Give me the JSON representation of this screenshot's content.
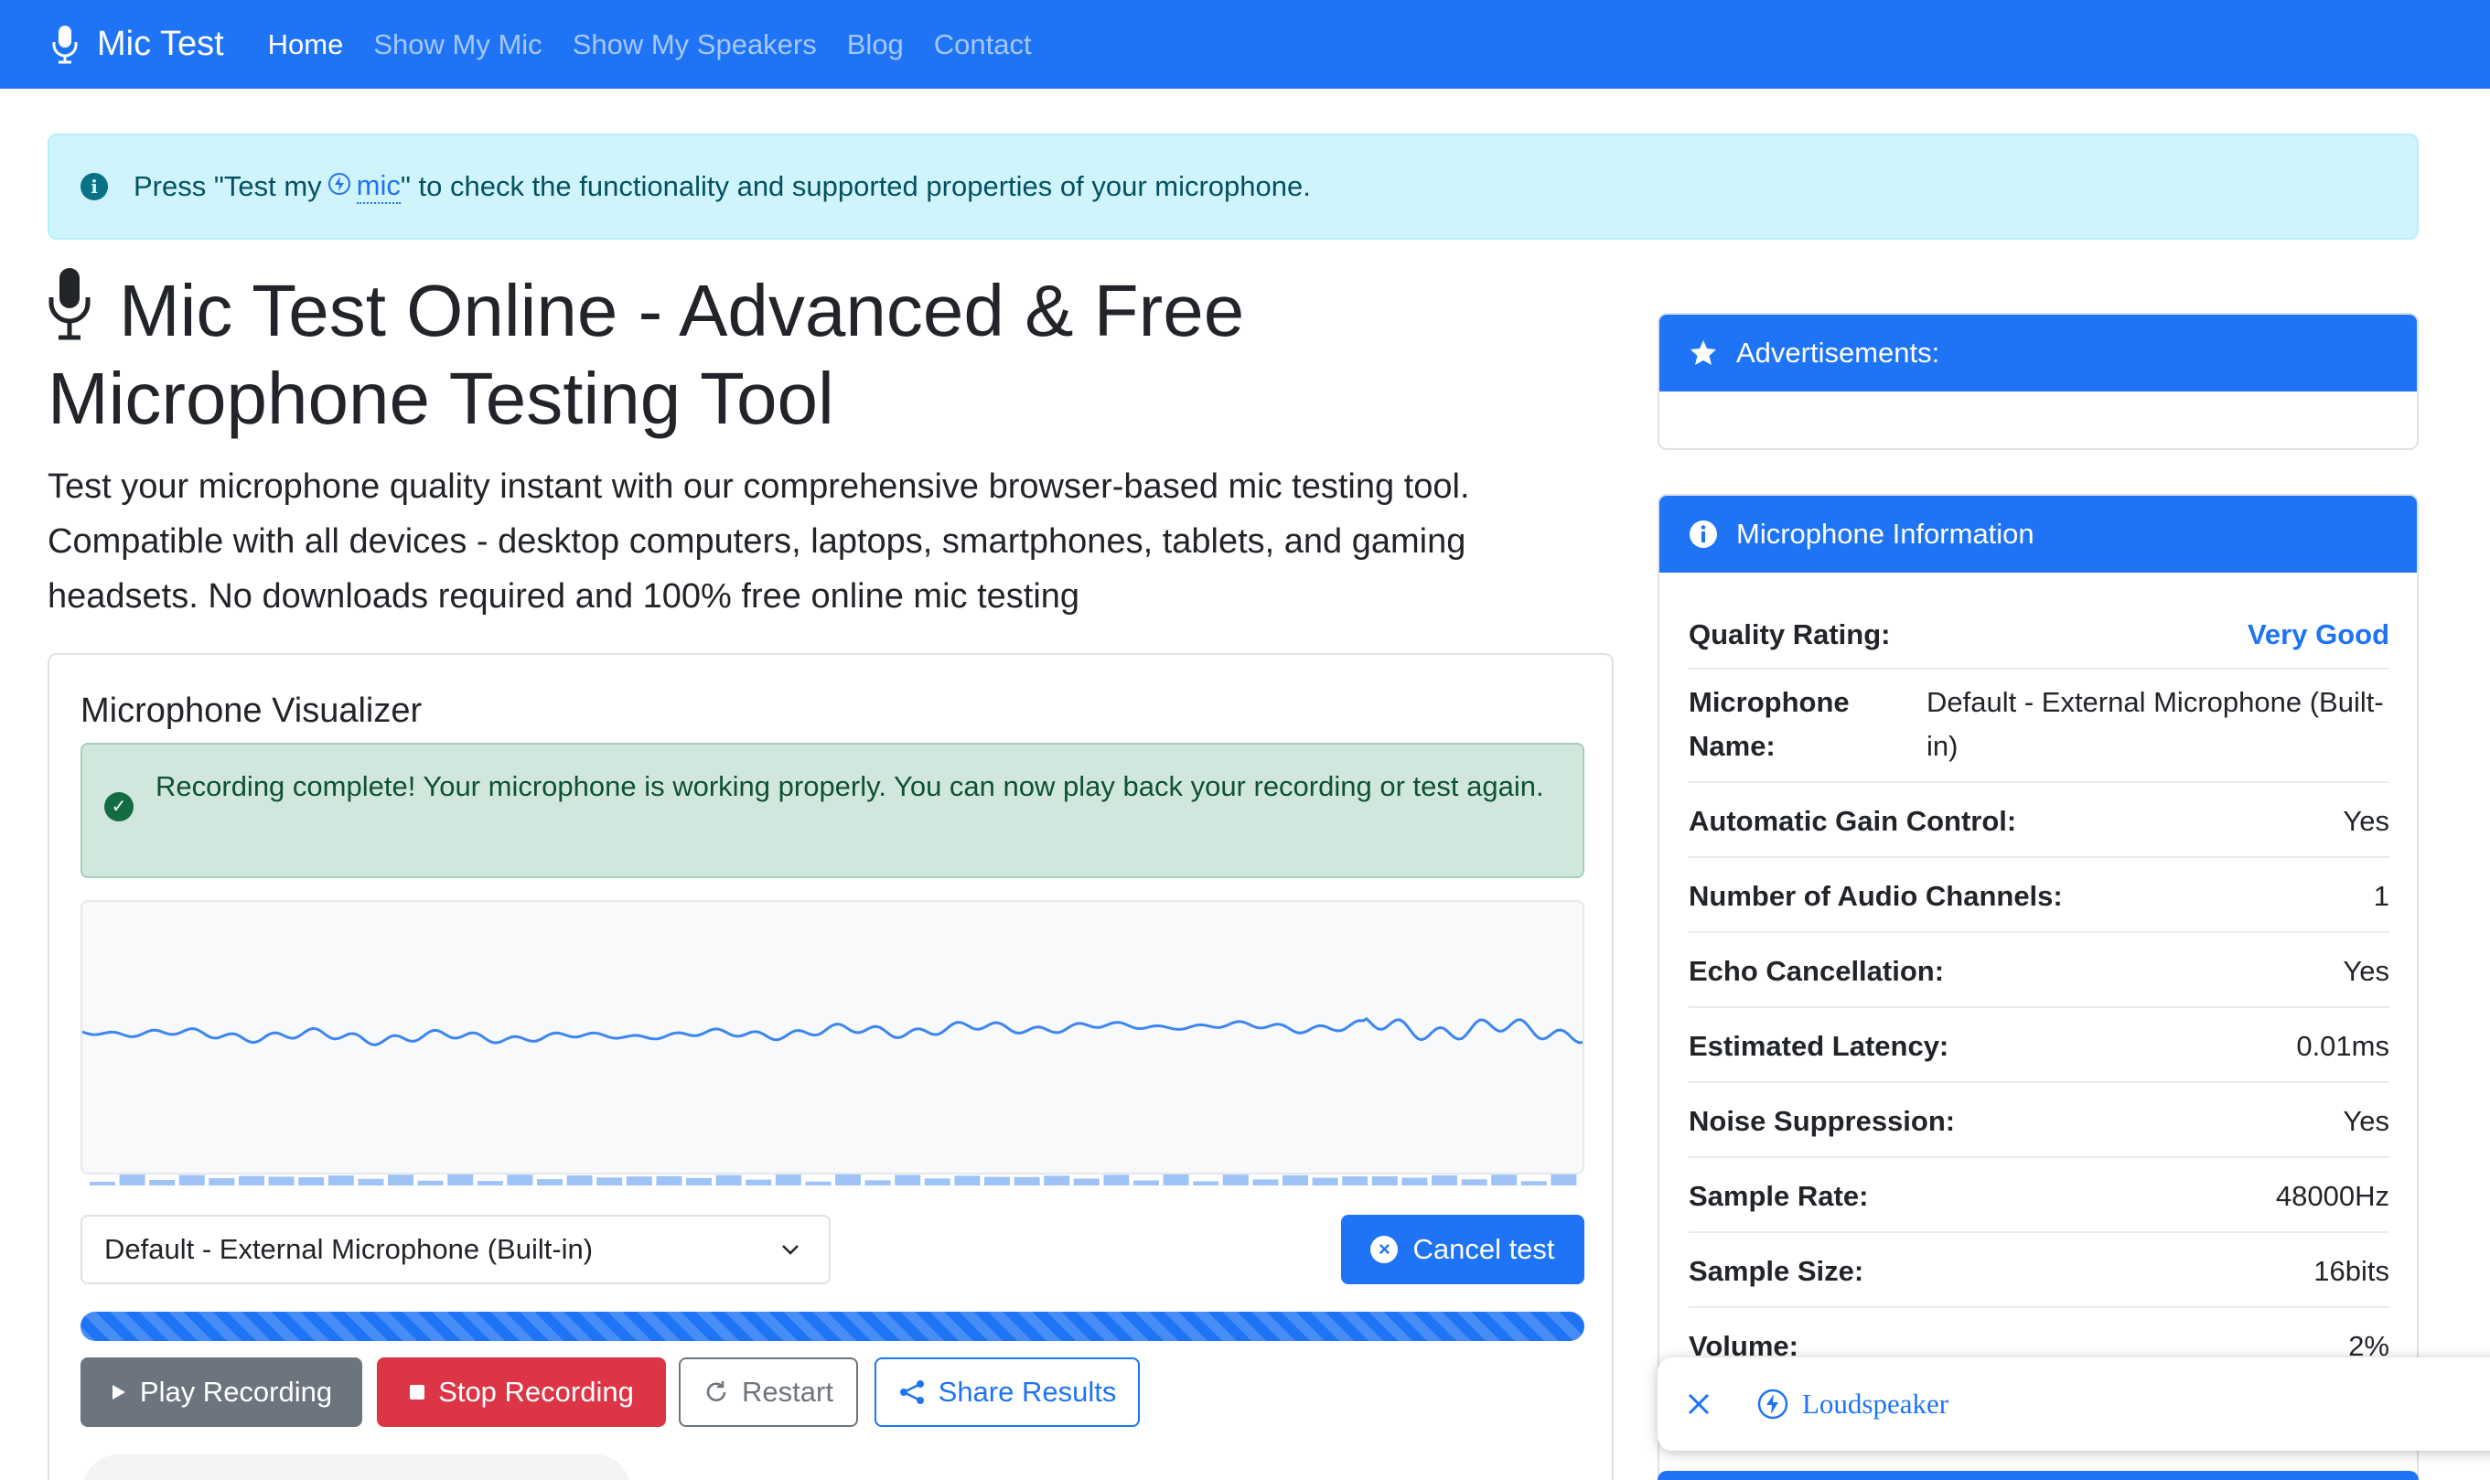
{
  "navbar": {
    "brand": "Mic Test",
    "links": [
      "Home",
      "Show My Mic",
      "Show My Speakers",
      "Blog",
      "Contact"
    ],
    "active": "Home"
  },
  "info_alert": {
    "prefix": "Press \"Test my",
    "link": "mic",
    "suffix": "\" to check the functionality and supported properties of your microphone."
  },
  "heading": {
    "line1": "Mic Test Online - Advanced & Free",
    "line2": "Microphone Testing Tool"
  },
  "lead": "Test your microphone quality instant with our comprehensive browser-based mic testing tool. Compatible with all devices - desktop computers, laptops, smartphones, tablets, and gaming headsets. No downloads required and 100% free online mic testing",
  "visualizer": {
    "title": "Microphone Visualizer",
    "success_msg": "Recording complete! Your microphone is working properly. You can now play back your recording or test again.",
    "selected_device": "Default - External Microphone (Built-in)",
    "cancel_label": "Cancel test",
    "progress_percent": 100,
    "play_label": "Play Recording",
    "stop_label": "Stop Recording",
    "restart_label": "Restart",
    "share_label": "Share Results"
  },
  "ads": {
    "title": "Advertisements:"
  },
  "mic_info": {
    "title": "Microphone Information",
    "quality_label": "Quality Rating:",
    "quality_value": "Very Good",
    "name_label": "Microphone Name:",
    "name_value": "Default - External Microphone (Built-in)",
    "agc_label": "Automatic Gain Control:",
    "agc_value": "Yes",
    "channels_label": "Number of Audio Channels:",
    "channels_value": "1",
    "echo_label": "Echo Cancellation:",
    "echo_value": "Yes",
    "latency_label": "Estimated Latency:",
    "latency_value": "0.01ms",
    "noise_label": "Noise Suppression:",
    "noise_value": "Yes",
    "rate_label": "Sample Rate:",
    "rate_value": "48000Hz",
    "size_label": "Sample Size:",
    "size_value": "16bits",
    "volume_label": "Volume:",
    "volume_value": "2%"
  },
  "popup": {
    "label": "Loudspeaker"
  },
  "colors": {
    "primary": "#1e74f5",
    "success_bg": "#d1e7dd",
    "info_bg": "#cff4fc",
    "danger": "#dc3545",
    "secondary": "#6c757d"
  }
}
